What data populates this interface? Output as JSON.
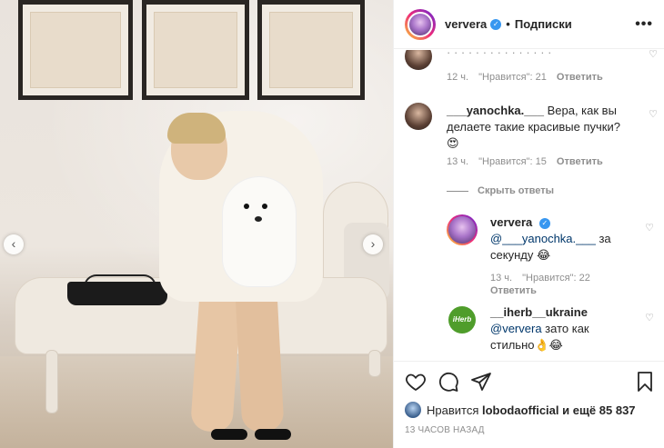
{
  "post": {
    "username": "ververa",
    "follow_label": "Подписки",
    "more_label": "•••"
  },
  "photo": {
    "prev_icon": "chevron-left-icon",
    "next_icon": "chevron-right-icon"
  },
  "comments": [
    {
      "partial_text": "",
      "time": "12 ч.",
      "likes": "\"Нравится\": 21",
      "reply": "Ответить"
    },
    {
      "user": "___yanochka.___",
      "text": "Вера, как вы делаете такие красивые пучки?",
      "emoji": "😍",
      "time": "13 ч.",
      "likes": "\"Нравится\": 15",
      "reply": "Ответить"
    }
  ],
  "hide_replies_label": "Скрыть ответы",
  "replies": [
    {
      "user": "ververa",
      "mention": "@___yanochka.___",
      "text": "за секунду",
      "emoji": "😂",
      "time": "13 ч.",
      "likes": "\"Нравится\": 22",
      "reply": "Ответить"
    },
    {
      "user": "__iherb__ukraine",
      "avatar_text": "iHerb",
      "mention": "@ververa",
      "text": "зато как стильно",
      "emoji": "👌😂"
    }
  ],
  "likes_summary": {
    "prefix": "Нравится",
    "user": "lobodaofficial",
    "suffix": "и ещё 85 837"
  },
  "timestamp": "13 ЧАСОВ НАЗАД",
  "colors": {
    "accent": "#3897f0",
    "meta_gray": "#8e8e8e",
    "mention": "#00376b",
    "herb_green": "#4f9d2b"
  }
}
